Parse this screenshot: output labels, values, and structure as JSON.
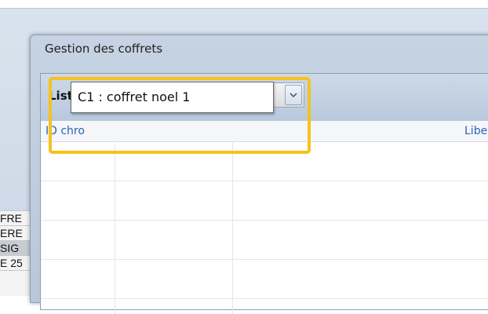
{
  "background_app": {
    "left_rows": [
      "FRE",
      "ERE",
      "SIG",
      "E 25"
    ]
  },
  "dialog": {
    "title": "Gestion des coffrets",
    "list_label": "Liste",
    "combo_value": "",
    "columns": [
      "ID chro",
      "Libe"
    ],
    "dropdown_options": [
      "C1 : coffret noel 1"
    ]
  },
  "colors": {
    "highlight": "#f7c21b",
    "column_header_text": "#2a62b8"
  }
}
